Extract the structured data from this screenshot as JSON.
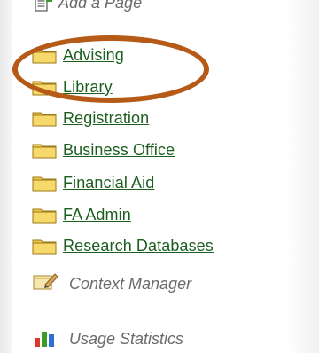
{
  "top_item": {
    "label": "Add a Page",
    "icon": "add-page-icon"
  },
  "folders": [
    {
      "label": "Advising",
      "icon": "folder-icon"
    },
    {
      "label": "Library",
      "icon": "folder-icon"
    },
    {
      "label": "Registration",
      "icon": "folder-icon"
    },
    {
      "label": "Business Office",
      "icon": "folder-icon"
    },
    {
      "label": "Financial Aid",
      "icon": "folder-icon"
    },
    {
      "label": "FA Admin",
      "icon": "folder-icon"
    },
    {
      "label": "Research Databases",
      "icon": "folder-icon"
    }
  ],
  "tools": [
    {
      "label": "Context Manager",
      "icon": "context-manager-icon"
    },
    {
      "label": "Usage Statistics",
      "icon": "bar-chart-icon"
    }
  ],
  "colors": {
    "link": "#1b5e20",
    "muted_text": "#6b6b6b",
    "highlight": "#b55a17",
    "folder": "#f2c94c"
  }
}
